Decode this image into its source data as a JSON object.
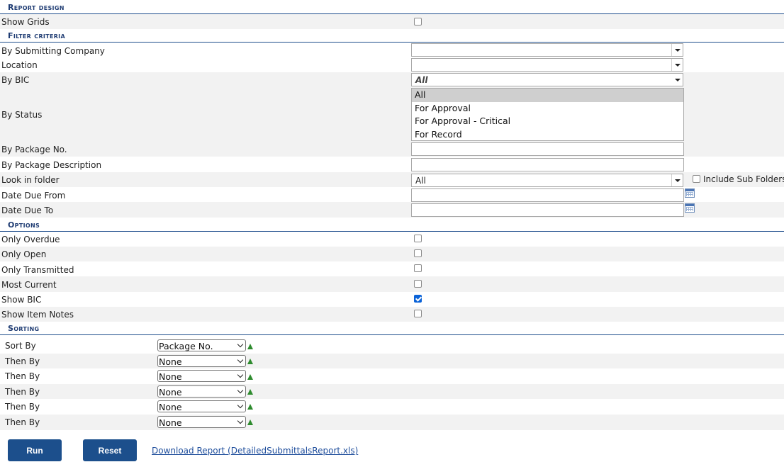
{
  "report_design": {
    "title": "Report design",
    "show_grids_label": "Show Grids",
    "show_grids_checked": false
  },
  "filter_criteria": {
    "title": "Filter criteria",
    "submitting_company_label": "By Submitting Company",
    "submitting_company_value": "",
    "location_label": "Location",
    "location_value": "",
    "bic_label": "By BIC",
    "bic_value": "All",
    "status_label": "By Status",
    "status_options": [
      "All",
      "For Approval",
      "For Approval - Critical",
      "For Record"
    ],
    "status_selected": "All",
    "package_no_label": "By Package No.",
    "package_desc_label": "By Package Description",
    "look_in_folder_label": "Look in folder",
    "look_in_folder_value": "All",
    "include_sub_folders_label": "Include Sub Folders",
    "include_sub_folders_checked": false,
    "date_due_from_label": "Date Due From",
    "date_due_to_label": "Date Due To"
  },
  "options": {
    "title": "Options",
    "items": [
      {
        "label": "Only Overdue",
        "checked": false
      },
      {
        "label": "Only Open",
        "checked": false
      },
      {
        "label": "Only Transmitted",
        "checked": false
      },
      {
        "label": "Most Current",
        "checked": false
      },
      {
        "label": "Show BIC",
        "checked": true
      },
      {
        "label": "Show Item Notes",
        "checked": false
      }
    ]
  },
  "sorting": {
    "title": "Sorting",
    "rows": [
      {
        "label": "Sort By",
        "value": "Package No."
      },
      {
        "label": "Then By",
        "value": "None"
      },
      {
        "label": "Then By",
        "value": "None"
      },
      {
        "label": "Then By",
        "value": "None"
      },
      {
        "label": "Then By",
        "value": "None"
      },
      {
        "label": "Then By",
        "value": "None"
      }
    ]
  },
  "actions": {
    "run_label": "Run",
    "reset_label": "Reset",
    "download_label": "Download Report (DetailedSubmittalsReport.xls)"
  },
  "icons": {
    "calendar": "calendar-icon",
    "sort_direction": "sort-ascending-icon",
    "dropdown": "chevron-down-icon"
  },
  "colors": {
    "section_header": "#1f3c73",
    "button": "#1c4f8c",
    "sort_arrow": "#2e8b2e",
    "checkbox_checked": "#0b63d8"
  }
}
